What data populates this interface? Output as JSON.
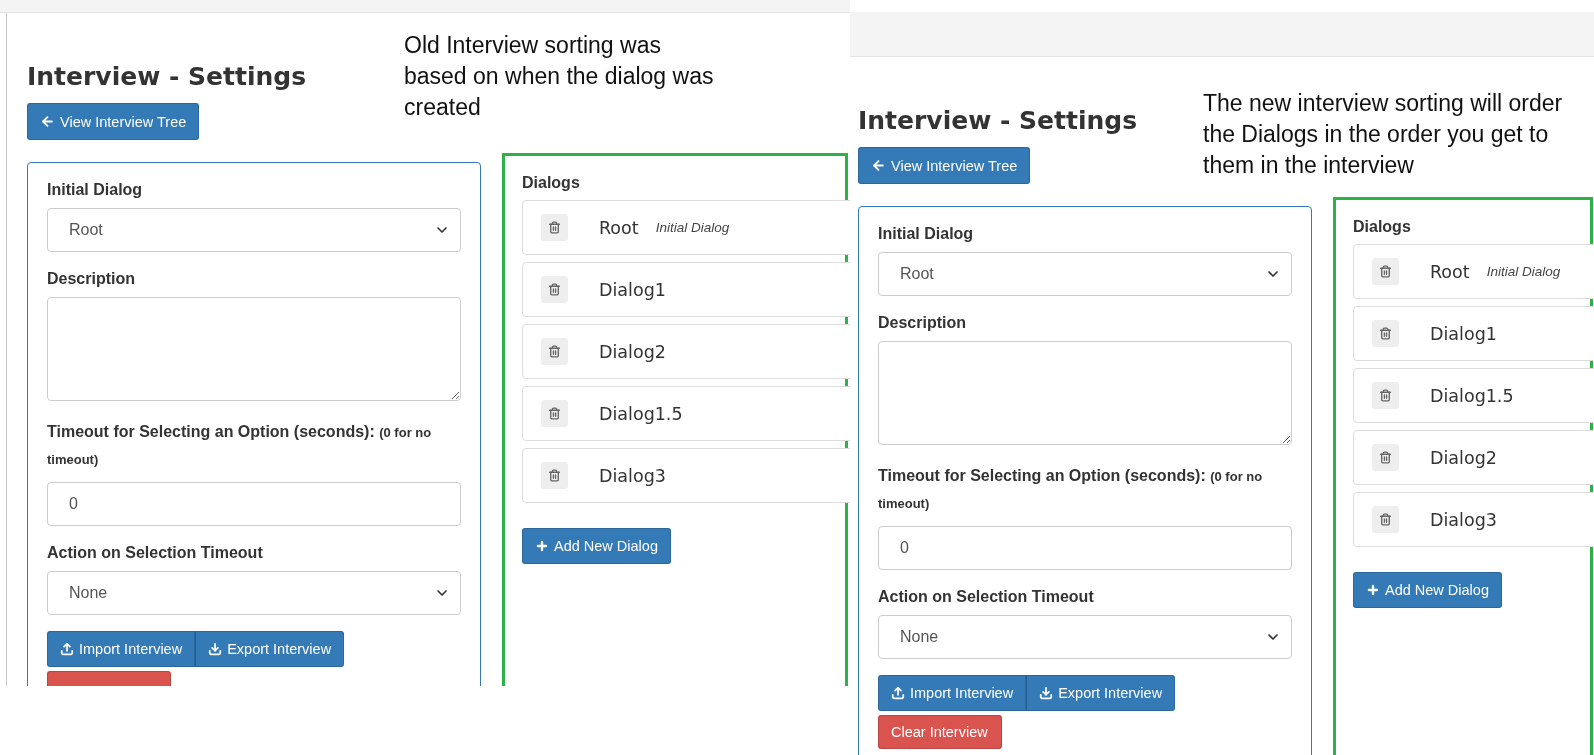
{
  "panels": [
    {
      "note": "Old Interview sorting was based on when the dialog was created",
      "title": "Interview - Settings",
      "back_button": "View Interview Tree",
      "form": {
        "initial_dialog": {
          "label": "Initial Dialog",
          "value": "Root"
        },
        "description": {
          "label": "Description"
        },
        "timeout": {
          "label": "Timeout for Selecting an Option (seconds):",
          "hint": "(0 for no timeout)",
          "value": "0"
        },
        "action": {
          "label": "Action on Selection Timeout",
          "value": "None"
        },
        "buttons": [
          "Import Interview",
          "Export Interview"
        ],
        "clear_button_edge": true
      },
      "dialogs": {
        "heading": "Dialogs",
        "items": [
          {
            "name": "Root",
            "tag": "Initial Dialog"
          },
          {
            "name": "Dialog1"
          },
          {
            "name": "Dialog2"
          },
          {
            "name": "Dialog1.5"
          },
          {
            "name": "Dialog3"
          }
        ],
        "add_button": "Add New Dialog"
      }
    },
    {
      "note": "The new interview sorting will order the Dialogs in the order you get to them in the interview",
      "title": "Interview - Settings",
      "back_button": "View Interview Tree",
      "form": {
        "initial_dialog": {
          "label": "Initial Dialog",
          "value": "Root"
        },
        "description": {
          "label": "Description"
        },
        "timeout": {
          "label": "Timeout for Selecting an Option (seconds):",
          "hint": "(0 for no timeout)",
          "value": "0"
        },
        "action": {
          "label": "Action on Selection Timeout",
          "value": "None"
        },
        "buttons": [
          "Import Interview",
          "Export Interview"
        ],
        "clear_button": "Clear Interview"
      },
      "dialogs": {
        "heading": "Dialogs",
        "items": [
          {
            "name": "Root",
            "tag": "Initial Dialog"
          },
          {
            "name": "Dialog1"
          },
          {
            "name": "Dialog1.5"
          },
          {
            "name": "Dialog2"
          },
          {
            "name": "Dialog3"
          }
        ],
        "add_button": "Add New Dialog"
      }
    }
  ]
}
